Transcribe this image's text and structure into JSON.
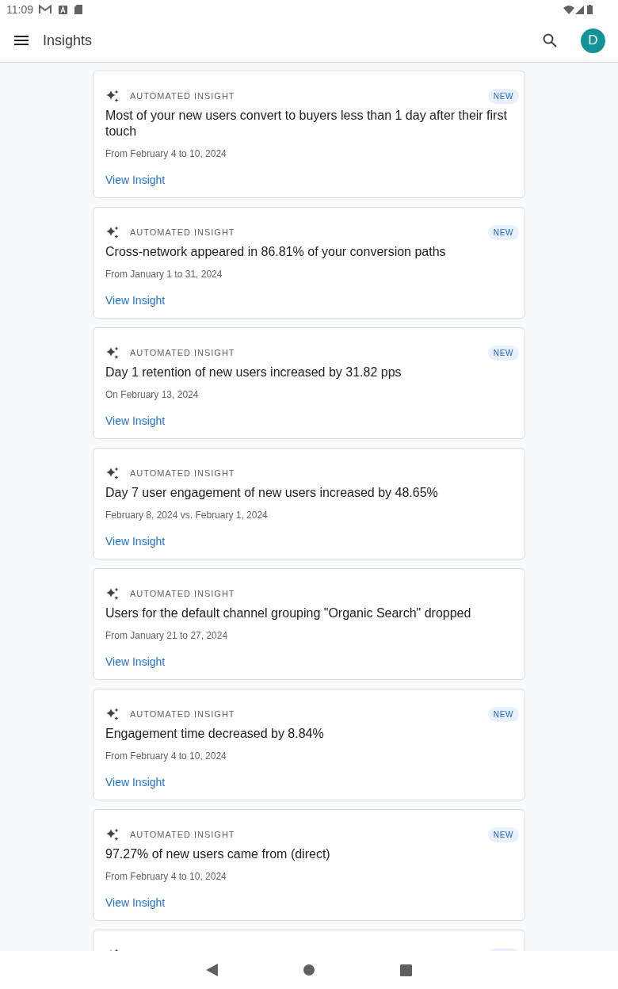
{
  "status_bar": {
    "time": "11:09"
  },
  "app_bar": {
    "title": "Insights",
    "avatar": "D"
  },
  "cards": [
    {
      "kind": "full",
      "label": "AUTOMATED INSIGHT",
      "new": true,
      "badge": "NEW",
      "title": "Most of your new users convert to buyers less than 1 day after their first touch",
      "date": "From February 4 to 10, 2024",
      "link": "View Insight"
    },
    {
      "kind": "full",
      "label": "AUTOMATED INSIGHT",
      "new": true,
      "badge": "NEW",
      "title": "Cross-network appeared in 86.81% of your conversion paths",
      "date": "From January 1 to 31, 2024",
      "link": "View Insight"
    },
    {
      "kind": "full",
      "label": "AUTOMATED INSIGHT",
      "new": true,
      "badge": "NEW",
      "title": "Day 1 retention of new users increased by 31.82 pps",
      "date": "On February 13, 2024",
      "link": "View Insight"
    },
    {
      "kind": "full",
      "label": "AUTOMATED INSIGHT",
      "new": false,
      "title": "Day 7 user engagement of new users increased by 48.65%",
      "date": "February 8, 2024 vs. February 1, 2024",
      "link": "View Insight"
    },
    {
      "kind": "full",
      "label": "AUTOMATED INSIGHT",
      "new": false,
      "title": "Users for the default channel grouping \"Organic Search\" dropped",
      "date": "From January 21 to 27, 2024",
      "link": "View Insight"
    },
    {
      "kind": "full",
      "label": "AUTOMATED INSIGHT",
      "new": true,
      "badge": "NEW",
      "title": "Engagement time decreased by 8.84%",
      "date": "From February 4 to 10, 2024",
      "link": "View Insight"
    },
    {
      "kind": "full",
      "label": "AUTOMATED INSIGHT",
      "new": true,
      "badge": "NEW",
      "title": "97.27% of new users came from (direct)",
      "date": "From February 4 to 10, 2024",
      "link": "View Insight"
    },
    {
      "kind": "partial",
      "new": true
    }
  ]
}
